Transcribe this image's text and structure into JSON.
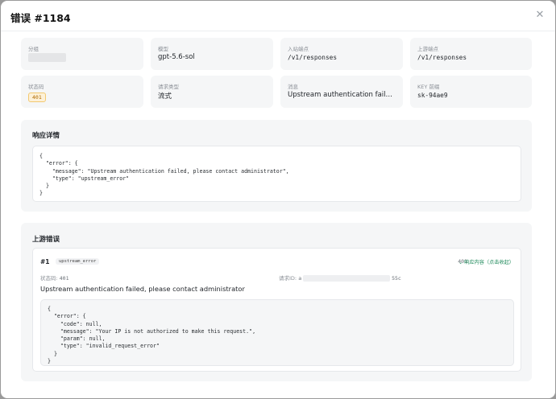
{
  "header": {
    "title": "错误 #1184",
    "close_icon": "close-icon"
  },
  "cards": [
    {
      "label": "分组",
      "value": "",
      "redacted": true
    },
    {
      "label": "模型",
      "value": "gpt-5.6-sol"
    },
    {
      "label": "入站端点",
      "value": "/v1/responses"
    },
    {
      "label": "上游端点",
      "value": "/v1/responses"
    },
    {
      "label": "状态码",
      "value": "401"
    },
    {
      "label": "请求类型",
      "value": "流式"
    },
    {
      "label": "消息",
      "value": "Upstream authentication failed, ple..."
    },
    {
      "label": "KEY 前缀",
      "value": "sk-94ae9"
    }
  ],
  "response": {
    "title": "响应详情",
    "body": "{\n  \"error\": {\n    \"message\": \"Upstream authentication failed, please contact administrator\",\n    \"type\": \"upstream_error\"\n  }\n}"
  },
  "upstream": {
    "title": "上游错误",
    "attempt": "#1",
    "tag": "upstream_error",
    "code": "401",
    "toggle_label": "响应内容（点击收起）",
    "status_label": "状态码: ",
    "status_value": "401",
    "request_label": "请求ID: ",
    "request_prefix": "a",
    "request_suffix": "55c",
    "message": "Upstream authentication failed, please contact administrator",
    "body": "{\n  \"error\": {\n    \"code\": null,\n    \"message\": \"Your IP is not authorized to make this request.\",\n    \"param\": null,\n    \"type\": \"invalid_request_error\"\n  }\n}"
  },
  "colors": {
    "accent": "#1f8a5b",
    "badge_bg": "#fdf1d8",
    "badge_text": "#b06a00",
    "card_bg": "#f5f6f7"
  }
}
